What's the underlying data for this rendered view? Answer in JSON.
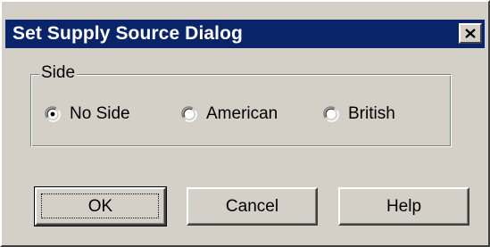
{
  "window": {
    "title": "Set Supply Source Dialog",
    "close_icon": "close-icon"
  },
  "side_group": {
    "label": "Side",
    "options": [
      {
        "label": "No Side",
        "selected": true
      },
      {
        "label": "American",
        "selected": false
      },
      {
        "label": "British",
        "selected": false
      }
    ]
  },
  "buttons": {
    "ok": "OK",
    "cancel": "Cancel",
    "help": "Help"
  },
  "colors": {
    "titlebar": "#0a246a",
    "face": "#d4d0c8"
  }
}
